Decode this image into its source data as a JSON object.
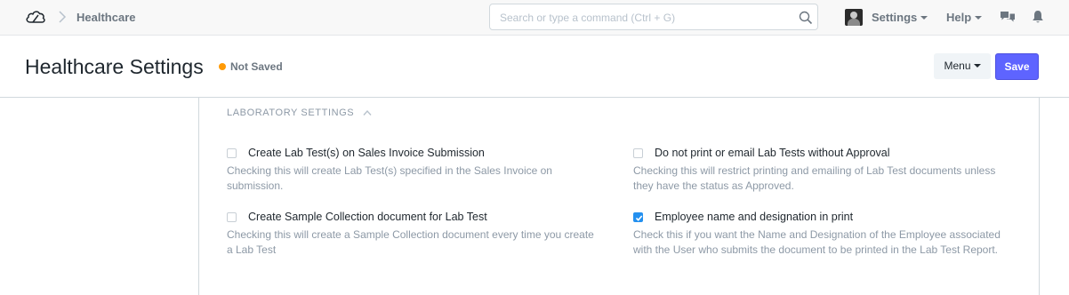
{
  "navbar": {
    "breadcrumb": "Healthcare",
    "search_placeholder": "Search or type a command (Ctrl + G)",
    "settings_label": "Settings",
    "help_label": "Help"
  },
  "page": {
    "title": "Healthcare Settings",
    "status": "Not Saved",
    "menu_label": "Menu",
    "save_label": "Save"
  },
  "section": {
    "title": "LABORATORY SETTINGS",
    "fields": [
      {
        "label": "Create Lab Test(s) on Sales Invoice Submission",
        "description": "Checking this will create Lab Test(s) specified in the Sales Invoice on submission.",
        "checked": false
      },
      {
        "label": "Do not print or email Lab Tests without Approval",
        "description": "Checking this will restrict printing and emailing of Lab Test documents unless they have the status as Approved.",
        "checked": false
      },
      {
        "label": "Create Sample Collection document for Lab Test",
        "description": "Checking this will create a Sample Collection document every time you create a Lab Test",
        "checked": false
      },
      {
        "label": "Employee name and designation in print",
        "description": "Check this if you want the Name and Designation of the Employee associated with the User who submits the document to be printed in the Lab Test Report.",
        "checked": true
      }
    ]
  },
  "colors": {
    "primary": "#5e64ff",
    "indicator_orange": "#ff9a06",
    "checkbox_blue": "#2490ef"
  }
}
